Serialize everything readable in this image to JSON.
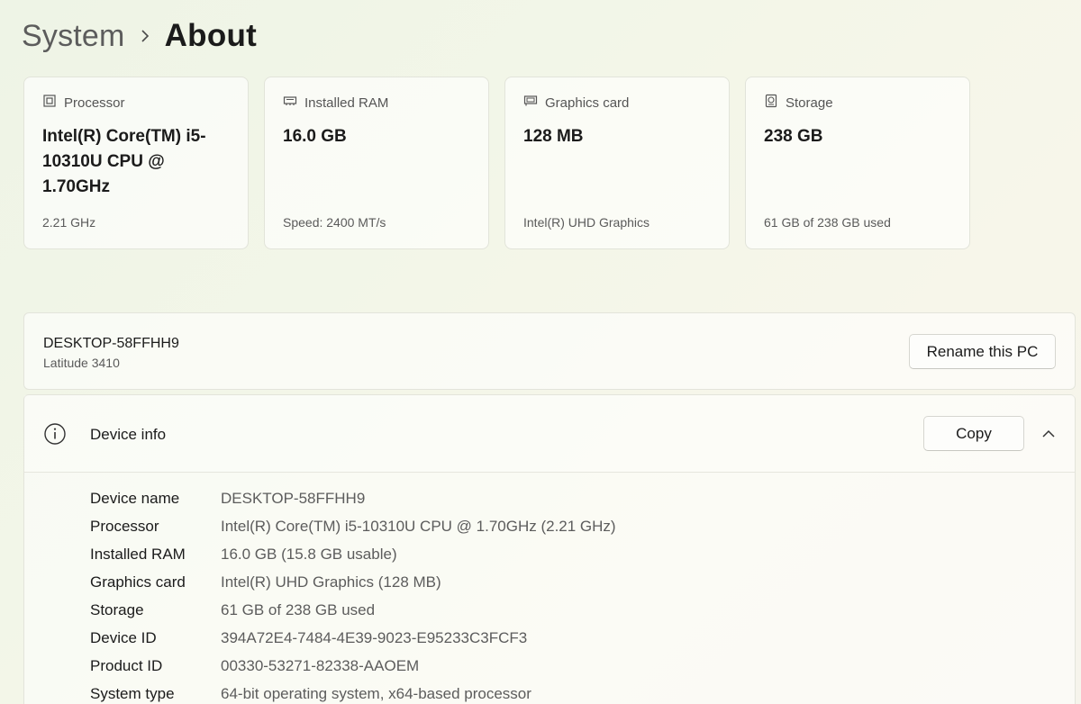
{
  "breadcrumb": {
    "parent": "System",
    "current": "About"
  },
  "cards": [
    {
      "icon": "processor-icon",
      "label": "Processor",
      "value": "Intel(R) Core(TM) i5-10310U CPU @ 1.70GHz",
      "sub": "2.21 GHz"
    },
    {
      "icon": "ram-icon",
      "label": "Installed RAM",
      "value": "16.0 GB",
      "sub": "Speed: 2400 MT/s"
    },
    {
      "icon": "graphics-card-icon",
      "label": "Graphics card",
      "value": "128 MB",
      "sub": "Intel(R) UHD Graphics"
    },
    {
      "icon": "storage-icon",
      "label": "Storage",
      "value": "238 GB",
      "sub": "61 GB of 238 GB used"
    }
  ],
  "pc": {
    "name": "DESKTOP-58FFHH9",
    "model": "Latitude 3410",
    "rename_label": "Rename this PC"
  },
  "device_info": {
    "title": "Device info",
    "copy_label": "Copy",
    "rows": [
      {
        "label": "Device name",
        "value": "DESKTOP-58FFHH9"
      },
      {
        "label": "Processor",
        "value": "Intel(R) Core(TM) i5-10310U CPU @ 1.70GHz (2.21 GHz)"
      },
      {
        "label": "Installed RAM",
        "value": "16.0 GB (15.8 GB usable)"
      },
      {
        "label": "Graphics card",
        "value": "Intel(R) UHD Graphics (128 MB)"
      },
      {
        "label": "Storage",
        "value": "61 GB of 238 GB used"
      },
      {
        "label": "Device ID",
        "value": "394A72E4-7484-4E39-9023-E95233C3FCF3"
      },
      {
        "label": "Product ID",
        "value": "00330-53271-82338-AAOEM"
      },
      {
        "label": "System type",
        "value": "64-bit operating system, x64-based processor"
      }
    ]
  },
  "icons": {
    "breadcrumb_separator": "chevron-right-icon",
    "info": "info-icon",
    "collapse": "chevron-up-icon"
  }
}
